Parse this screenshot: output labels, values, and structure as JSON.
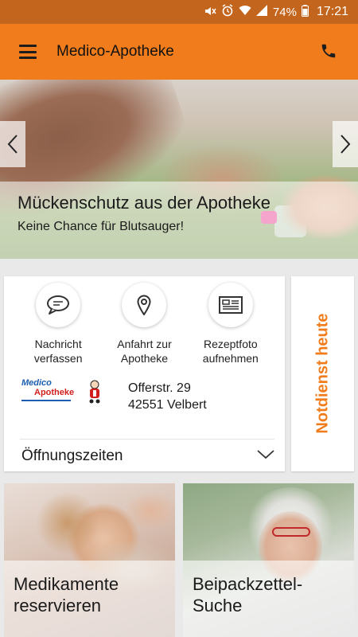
{
  "status_bar": {
    "battery": "74%",
    "time": "17:21",
    "icons": [
      "mute-icon",
      "alarm-icon",
      "wifi-icon",
      "signal-icon",
      "battery-icon"
    ]
  },
  "app_bar": {
    "title": "Medico-Apotheke",
    "menu_icon": "menu-icon",
    "phone_icon": "phone-icon",
    "background": "#f07c1c"
  },
  "hero": {
    "title": "Mückenschutz aus der Apotheke",
    "subtitle": "Keine Chance für Blutsauger!"
  },
  "actions": [
    {
      "label": "Nachricht\nverfassen",
      "icon": "chat-bubble-icon"
    },
    {
      "label": "Anfahrt zur\nApotheke",
      "icon": "map-pin-icon"
    },
    {
      "label": "Rezeptfoto\naufnehmen",
      "icon": "prescription-icon"
    }
  ],
  "pharmacy": {
    "logo_text_1": "Medico",
    "logo_text_2": "Apotheke",
    "street": "Offerstr. 29",
    "city": "42551 Velbert"
  },
  "hours": {
    "label": "Öffnungszeiten"
  },
  "notdienst": {
    "label": "Notdienst heute"
  },
  "tiles": [
    {
      "label": "Medikamente\nreservieren"
    },
    {
      "label": "Beipackzettel-\nSuche"
    }
  ],
  "colors": {
    "accent": "#f07c1c",
    "status_bar": "#c4651d"
  }
}
